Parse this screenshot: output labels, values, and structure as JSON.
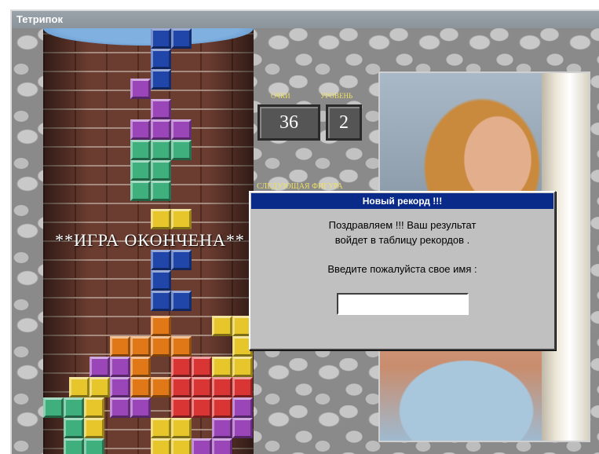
{
  "window": {
    "title": "Тетрипок"
  },
  "game": {
    "score_label": "ОЧКИ",
    "level_label": "УРОВЕНЬ",
    "score": "36",
    "level": "2",
    "next_label": "СЛЕДУЮЩАЯ ФИГУРА",
    "game_over_text": "**ИГРА ОКОНЧЕНА**"
  },
  "dialog": {
    "title": "Новый рекорд !!!",
    "message_line1": "Поздравляем !!!  Ваш результат",
    "message_line2": "войдет в таблицу рекордов .",
    "prompt": "Введите пожалуйста свое имя :",
    "name_value": "",
    "name_placeholder": ""
  },
  "colors": {
    "blue": "#1f46a8",
    "purple": "#9a45b8",
    "green": "#3fb07d",
    "yellow": "#e6c62a",
    "orange": "#e07818",
    "red": "#d93535"
  }
}
